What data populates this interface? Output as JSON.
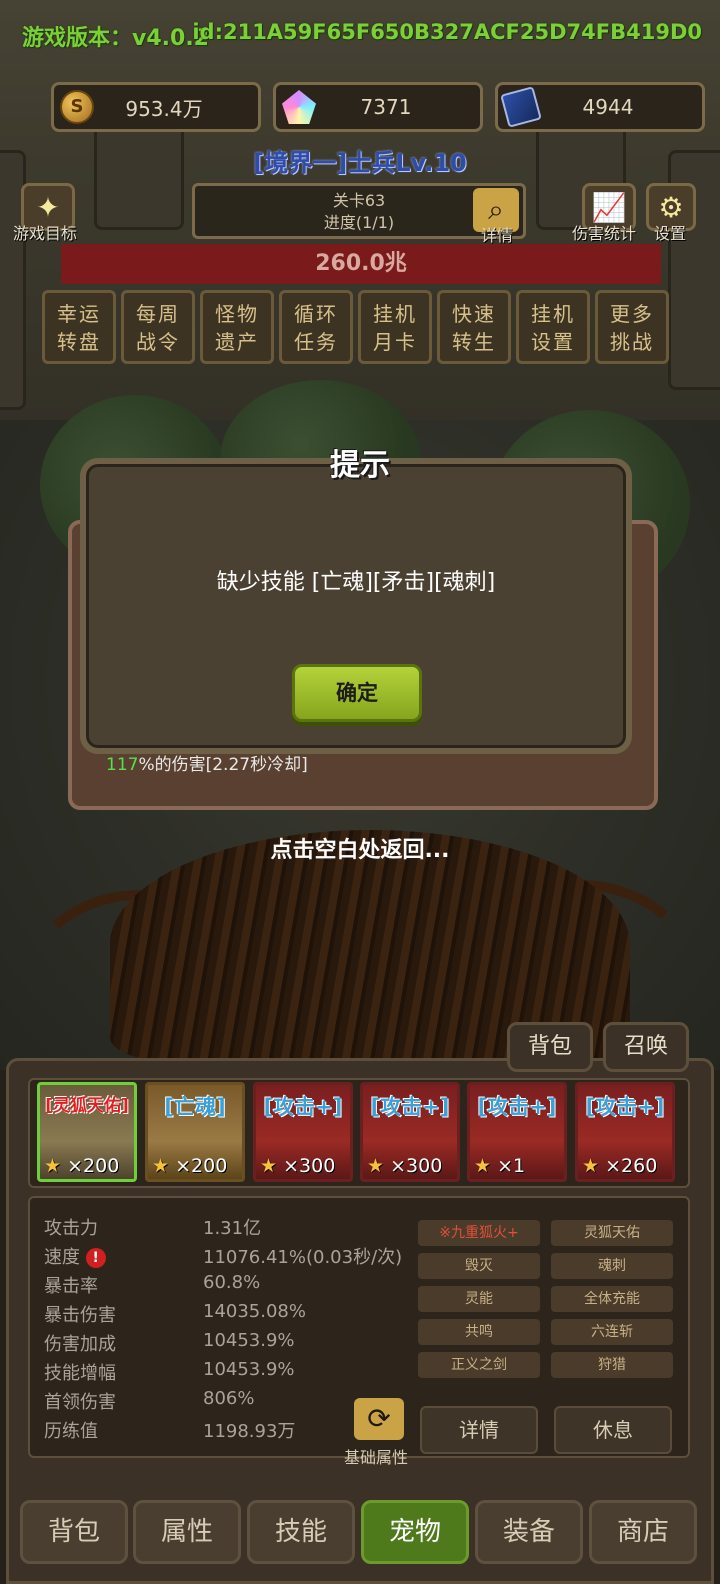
{
  "colors": {
    "accent_green": "#7dcf3a",
    "hp_red": "#7a1a1a",
    "ok_button": "#9dbd2a",
    "active_tab": "#4f7a1c",
    "highlight_red": "#e0503a"
  },
  "header": {
    "version": "游戏版本：v4.0.2",
    "user_id": "id:211A59F65F650B327ACF25D74FB419D0",
    "resources": [
      {
        "icon": "coin-icon",
        "value": "953.4万"
      },
      {
        "icon": "crystal-icon",
        "value": "7371"
      },
      {
        "icon": "card-icon",
        "value": "4944"
      }
    ],
    "rank": "[境界一]士兵Lv.10"
  },
  "toolbar": {
    "goal_label": "游戏目标",
    "stage_title": "关卡63",
    "stage_progress": "进度(1/1)",
    "details_label": "详情",
    "damage_stats_label": "伤害统计",
    "settings_label": "设置"
  },
  "boss_hp": "260.0兆",
  "features": [
    {
      "line1": "幸运",
      "line2": "转盘"
    },
    {
      "line1": "每周",
      "line2": "战令"
    },
    {
      "line1": "怪物",
      "line2": "遗产"
    },
    {
      "line1": "循环",
      "line2": "任务"
    },
    {
      "line1": "挂机",
      "line2": "月卡"
    },
    {
      "line1": "快速",
      "line2": "转生"
    },
    {
      "line1": "挂机",
      "line2": "设置"
    },
    {
      "line1": "更多",
      "line2": "挑战"
    }
  ],
  "background_panel": {
    "damage_pct": "117",
    "damage_text": "%的伤害[2.27秒冷却]"
  },
  "dialog": {
    "title": "提示",
    "message": "缺少技能 [亡魂][矛击][魂刺]",
    "confirm": "确定",
    "dismiss_hint": "点击空白处返回..."
  },
  "pet_panel": {
    "tabs": {
      "bag": "背包",
      "summon": "召唤"
    },
    "pets": [
      {
        "name": "[灵狐天佑]",
        "count": "×200",
        "selected": true
      },
      {
        "name": "[亡魂]",
        "count": "×200"
      },
      {
        "name": "[攻击+]",
        "count": "×300"
      },
      {
        "name": "[攻击+]",
        "count": "×300"
      },
      {
        "name": "[攻击+]",
        "count": "×1"
      },
      {
        "name": "[攻击+]",
        "count": "×260"
      }
    ],
    "stats": [
      {
        "label": "攻击力",
        "value": "1.31亿"
      },
      {
        "label": "速度",
        "value": "11076.41%(0.03秒/次)",
        "warning": "!"
      },
      {
        "label": "暴击率",
        "value": "60.8%"
      },
      {
        "label": "暴击伤害",
        "value": "14035.08%"
      },
      {
        "label": "伤害加成",
        "value": "10453.9%"
      },
      {
        "label": "技能增幅",
        "value": "10453.9%"
      },
      {
        "label": "首领伤害",
        "value": "806%"
      },
      {
        "label": "历练值",
        "value": "1198.93万"
      }
    ],
    "skills": [
      "※九重狐火+",
      "灵狐天佑",
      "毁灭",
      "魂刺",
      "灵能",
      "全体充能",
      "共鸣",
      "六连斩",
      "正义之剑",
      "狩猎"
    ],
    "base_attr_label": "基础属性",
    "details_btn": "详情",
    "rest_btn": "休息"
  },
  "nav": [
    "背包",
    "属性",
    "技能",
    "宠物",
    "装备",
    "商店"
  ],
  "nav_active_index": 3
}
